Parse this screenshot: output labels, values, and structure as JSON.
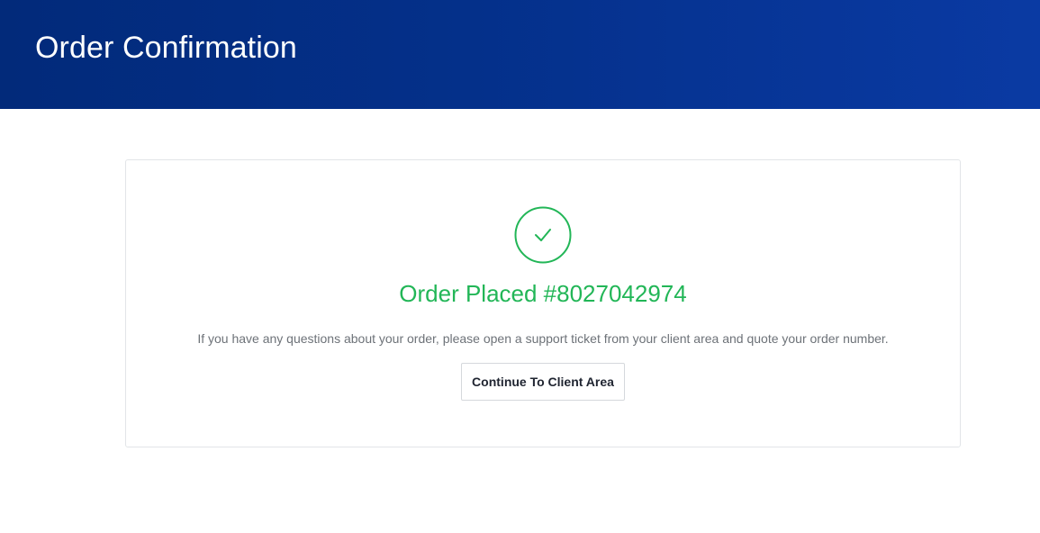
{
  "header": {
    "title": "Order Confirmation"
  },
  "confirmation": {
    "icon": "checkmark-circle-icon",
    "heading_prefix": "Order Placed ",
    "order_number": "#8027042974",
    "message": "If you have any questions about your order, please open a support ticket from your client area and quote your order number.",
    "continue_label": "Continue To Client Area"
  },
  "colors": {
    "header_start": "#022a7a",
    "header_end": "#0a3aa3",
    "success": "#22b657",
    "muted_text": "#6d7278",
    "border": "#e2e5e8"
  }
}
